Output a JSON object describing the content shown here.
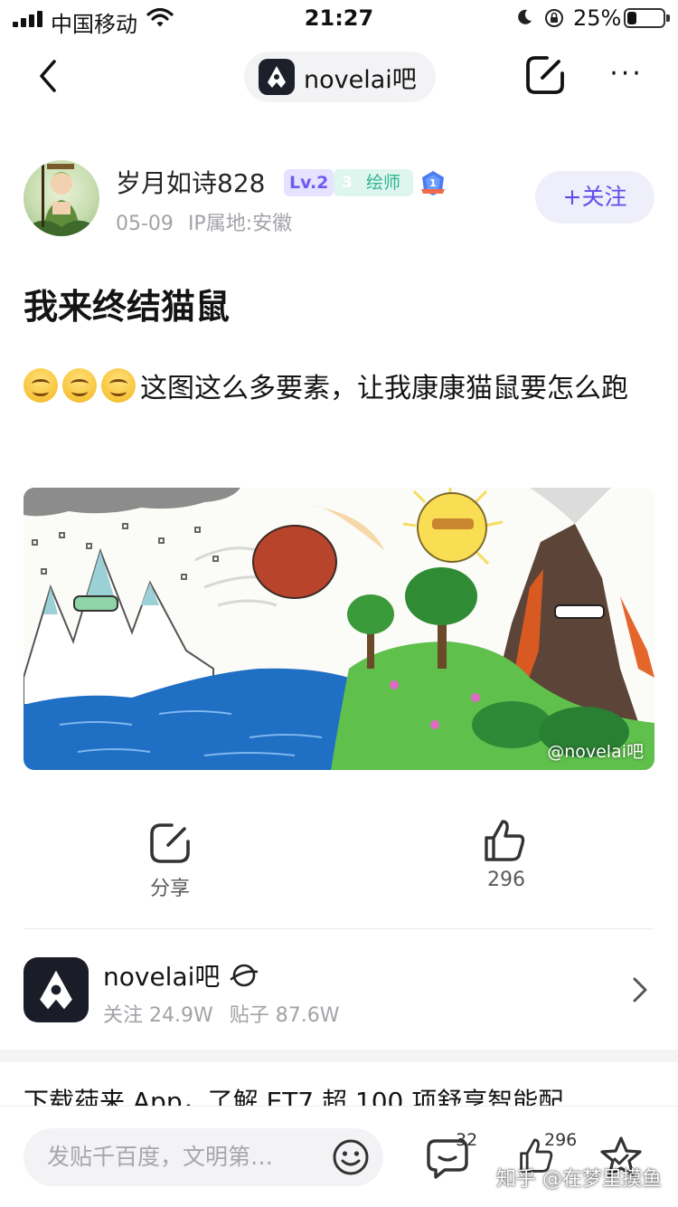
{
  "status_bar": {
    "carrier": "中国移动",
    "time": "21:27",
    "battery": "25%"
  },
  "nav": {
    "forum_name": "novelai吧",
    "more": "···"
  },
  "author": {
    "username": "岁月如诗828",
    "level": "Lv.2",
    "role_level": "3",
    "role": "绘师",
    "medal_rank": "1",
    "date": "05-09",
    "ip_location": "IP属地:安徽",
    "follow_label": "+关注"
  },
  "post": {
    "title": "我来终结猫鼠",
    "body": "这图这么多要素，让我康康猫鼠要怎么跑",
    "emoji_count": 3,
    "image_watermark": "@novelai吧"
  },
  "actions": {
    "share_label": "分享",
    "like_count": "296"
  },
  "forum_card": {
    "name": "novelai吧",
    "followers": "关注 24.9W",
    "posts": "贴子 87.6W"
  },
  "promo_text": "下载莼来 App，了解 ET7 超 100 项舒享智能配",
  "bottom_bar": {
    "reply_placeholder": "发贴千百度，文明第…",
    "comment_count": "32",
    "like_count": "296",
    "watermark": "知乎 @在梦里摸鱼"
  }
}
